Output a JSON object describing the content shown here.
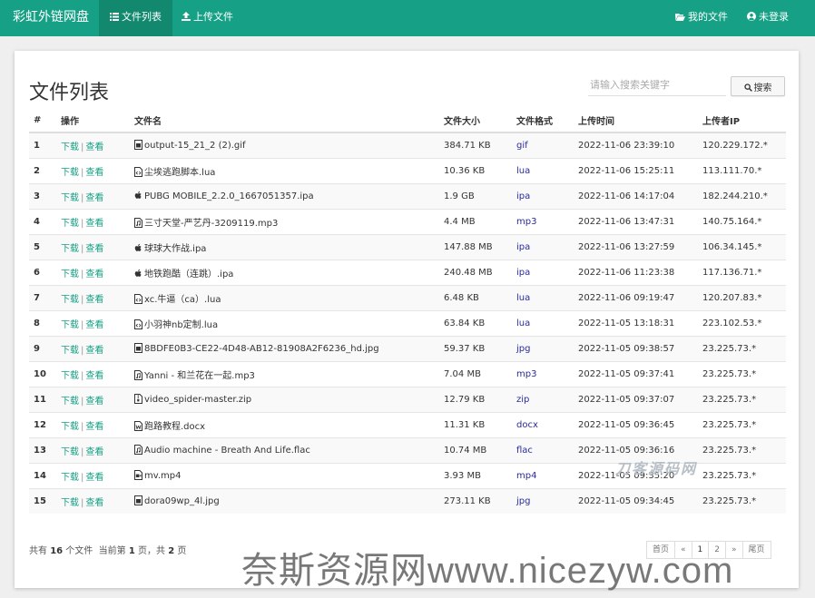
{
  "navbar": {
    "brand": "彩虹外链网盘",
    "left_items": [
      {
        "label": "文件列表",
        "icon": "list-icon",
        "active": true
      },
      {
        "label": "上传文件",
        "icon": "upload-icon",
        "active": false
      }
    ],
    "right_items": [
      {
        "label": "我的文件",
        "icon": "folder-open-icon"
      },
      {
        "label": "未登录",
        "icon": "user-circle-icon"
      }
    ],
    "bg_color": "#16a085"
  },
  "page": {
    "title": "文件列表",
    "search_placeholder": "请输入搜索关键字",
    "search_button": "搜索"
  },
  "table": {
    "headers": [
      "#",
      "操作",
      "文件名",
      "文件大小",
      "文件格式",
      "上传时间",
      "上传者IP"
    ],
    "action_download": "下载",
    "action_separator": "|",
    "action_view": "查看",
    "rows": [
      {
        "num": "1",
        "icon": "image-file-icon",
        "name": "output-15_21_2 (2).gif",
        "size": "384.71 KB",
        "format": "gif",
        "time": "2022-11-06 23:39:10",
        "ip": "120.229.172.*"
      },
      {
        "num": "2",
        "icon": "code-file-icon",
        "name": "尘埃逃跑脚本.lua",
        "size": "10.36 KB",
        "format": "lua",
        "time": "2022-11-06 15:25:11",
        "ip": "113.111.70.*"
      },
      {
        "num": "3",
        "icon": "apple-icon",
        "name": "PUBG MOBILE_2.2.0_1667051357.ipa",
        "size": "1.9 GB",
        "format": "ipa",
        "time": "2022-11-06 14:17:04",
        "ip": "182.244.210.*"
      },
      {
        "num": "4",
        "icon": "audio-file-icon",
        "name": "三寸天堂-严艺丹-3209119.mp3",
        "size": "4.4 MB",
        "format": "mp3",
        "time": "2022-11-06 13:47:31",
        "ip": "140.75.164.*"
      },
      {
        "num": "5",
        "icon": "apple-icon",
        "name": "球球大作战.ipa",
        "size": "147.88 MB",
        "format": "ipa",
        "time": "2022-11-06 13:27:59",
        "ip": "106.34.145.*"
      },
      {
        "num": "6",
        "icon": "apple-icon",
        "name": "地铁跑酷（连跳）.ipa",
        "size": "240.48 MB",
        "format": "ipa",
        "time": "2022-11-06 11:23:38",
        "ip": "117.136.71.*"
      },
      {
        "num": "7",
        "icon": "code-file-icon",
        "name": "xc.牛逼（ca）.lua",
        "size": "6.48 KB",
        "format": "lua",
        "time": "2022-11-06 09:19:47",
        "ip": "120.207.83.*"
      },
      {
        "num": "8",
        "icon": "code-file-icon",
        "name": "小羽神nb定制.lua",
        "size": "63.84 KB",
        "format": "lua",
        "time": "2022-11-05 13:18:31",
        "ip": "223.102.53.*"
      },
      {
        "num": "9",
        "icon": "image-file-icon",
        "name": "8BDFE0B3-CE22-4D48-AB12-81908A2F6236_hd.jpg",
        "size": "59.37 KB",
        "format": "jpg",
        "time": "2022-11-05 09:38:57",
        "ip": "23.225.73.*"
      },
      {
        "num": "10",
        "icon": "audio-file-icon",
        "name": "Yanni - 和兰花在一起.mp3",
        "size": "7.04 MB",
        "format": "mp3",
        "time": "2022-11-05 09:37:41",
        "ip": "23.225.73.*"
      },
      {
        "num": "11",
        "icon": "archive-file-icon",
        "name": "video_spider-master.zip",
        "size": "12.79 KB",
        "format": "zip",
        "time": "2022-11-05 09:37:07",
        "ip": "23.225.73.*"
      },
      {
        "num": "12",
        "icon": "word-file-icon",
        "name": "跑路教程.docx",
        "size": "11.31 KB",
        "format": "docx",
        "time": "2022-11-05 09:36:45",
        "ip": "23.225.73.*"
      },
      {
        "num": "13",
        "icon": "audio-file-icon",
        "name": "Audio machine - Breath And Life.flac",
        "size": "10.74 MB",
        "format": "flac",
        "time": "2022-11-05 09:36:16",
        "ip": "23.225.73.*"
      },
      {
        "num": "14",
        "icon": "video-file-icon",
        "name": "mv.mp4",
        "size": "3.93 MB",
        "format": "mp4",
        "time": "2022-11-05 09:35:20",
        "ip": "23.225.73.*"
      },
      {
        "num": "15",
        "icon": "image-file-icon",
        "name": "dora09wp_4l.jpg",
        "size": "273.11 KB",
        "format": "jpg",
        "time": "2022-11-05 09:34:45",
        "ip": "23.225.73.*"
      }
    ]
  },
  "pager": {
    "prefix": "共有",
    "total": "16",
    "mid1": "个文件  当前第",
    "current": "1",
    "mid2": "页，共",
    "pages": "2",
    "suffix": "页",
    "buttons": [
      "首页",
      "«",
      "1",
      "2",
      "»",
      "尾页"
    ]
  },
  "watermarks": {
    "big": "奈斯资源网www.nicezyw.com",
    "small": "刀客源码网"
  }
}
